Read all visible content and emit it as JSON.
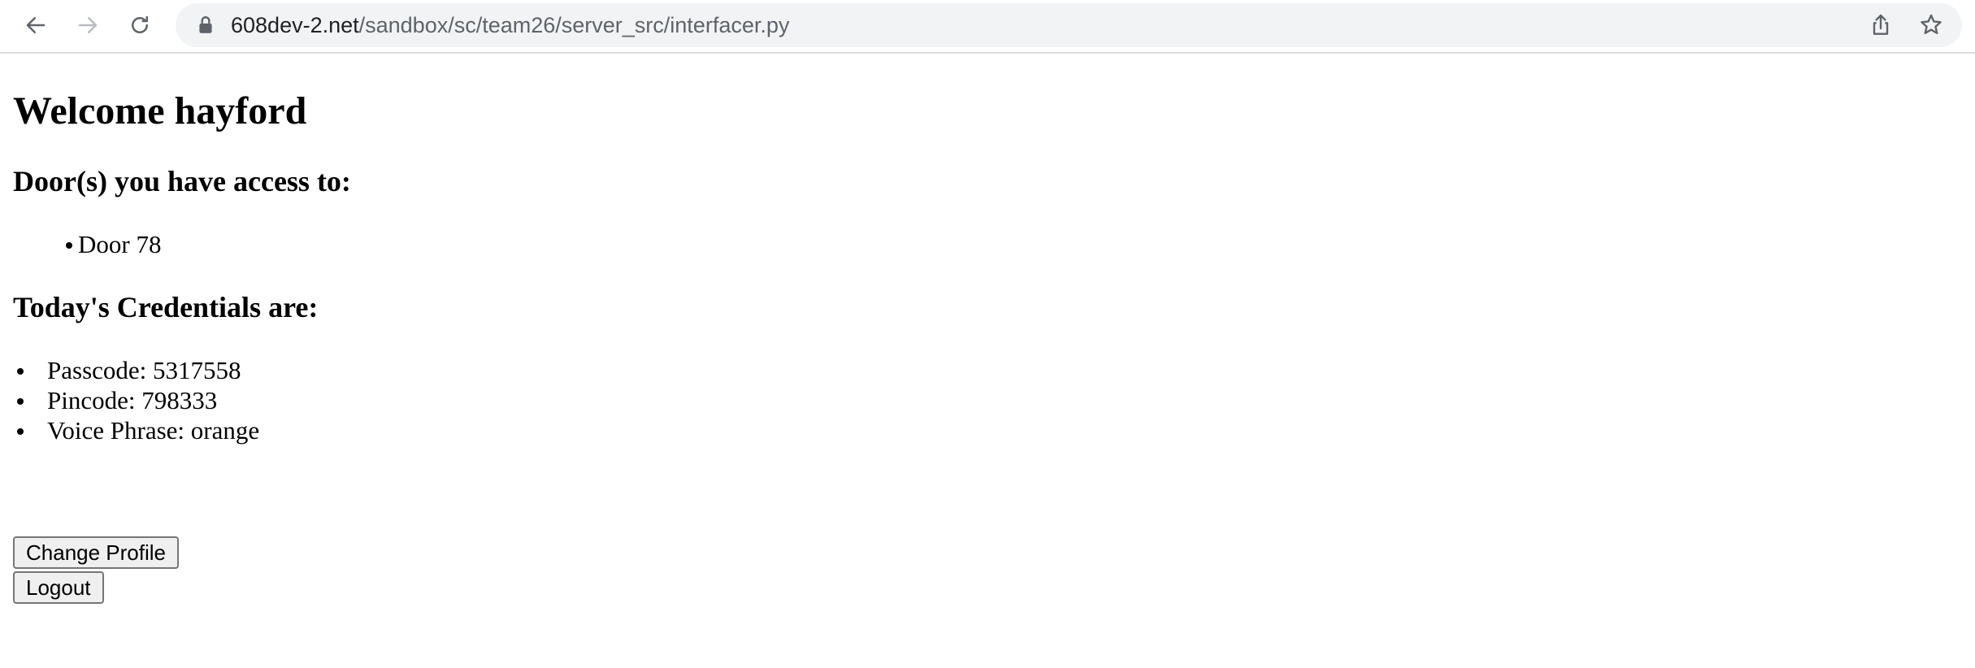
{
  "browser": {
    "back_icon": "arrow-left-icon",
    "forward_icon": "arrow-right-icon",
    "reload_icon": "reload-icon",
    "lock_icon": "lock-icon",
    "share_icon": "share-icon",
    "bookmark_icon": "star-icon",
    "url_host": "608dev-2.net",
    "url_path": "/sandbox/sc/team26/server_src/interfacer.py"
  },
  "page": {
    "welcome": "Welcome hayford",
    "doors_heading": "Door(s) you have access to:",
    "doors": [
      "Door 78"
    ],
    "credentials_heading": "Today's Credentials are:",
    "credentials": [
      "Passcode: 5317558",
      "Pincode: 798333",
      "Voice Phrase: orange"
    ],
    "change_profile_label": "Change Profile",
    "logout_label": "Logout"
  },
  "colors": {
    "toolbar_bg": "#ffffff",
    "omnibox_bg": "#f1f3f4",
    "url_host": "#202124",
    "url_path": "#5f6368",
    "button_bg": "#efefef",
    "button_border": "#767676"
  }
}
